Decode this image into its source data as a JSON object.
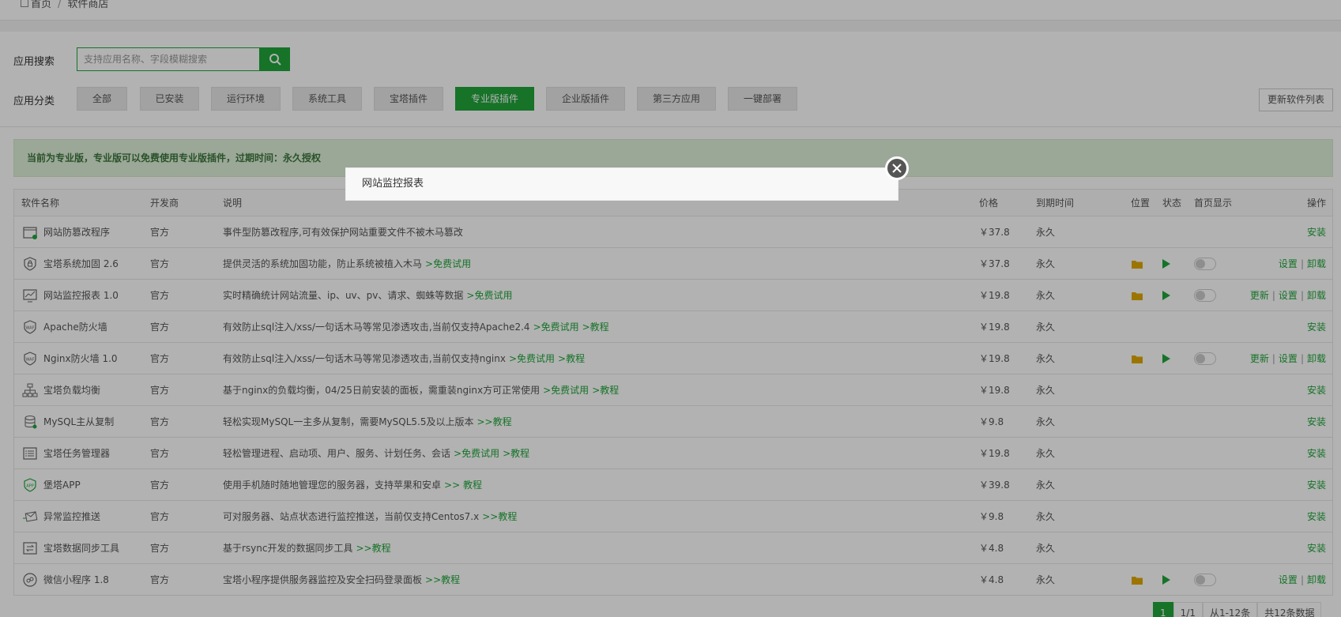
{
  "breadcrumb": {
    "home": "首页",
    "sep": "/",
    "current": "软件商店"
  },
  "search": {
    "label": "应用搜索",
    "placeholder": "支持应用名称、字段模糊搜索"
  },
  "categories": {
    "label": "应用分类",
    "items": [
      "全部",
      "已安装",
      "运行环境",
      "系统工具",
      "宝塔插件",
      "专业版插件",
      "企业版插件",
      "第三方应用",
      "一键部署"
    ],
    "active": "专业版插件"
  },
  "update_button": "更新软件列表",
  "notice": "当前为专业版，专业版可以免费使用专业版插件，过期时间：永久授权",
  "table": {
    "headers": {
      "name": "软件名称",
      "dev": "开发商",
      "desc": "说明",
      "price": "价格",
      "expire": "到期时间",
      "position": "位置",
      "state": "状态",
      "home": "首页显示",
      "ops": "操作"
    },
    "rows": [
      {
        "name": "网站防篡改程序",
        "icon": "website-shield-icon",
        "dev": "官方",
        "desc": "事件型防篡改程序,可有效保护网站重要文件不被木马篡改",
        "links": [],
        "price": "￥37.8",
        "expire": "永久",
        "installed": false,
        "ops": [
          "安装"
        ]
      },
      {
        "name": "宝塔系统加固 2.6",
        "icon": "lock-shield-icon",
        "dev": "官方",
        "desc": "提供灵活的系统加固功能，防止系统被植入木马",
        "links": [
          ">免费试用"
        ],
        "price": "￥37.8",
        "expire": "永久",
        "installed": true,
        "ops": [
          "设置",
          "卸载"
        ]
      },
      {
        "name": "网站监控报表 1.0",
        "icon": "monitor-chart-icon",
        "dev": "官方",
        "desc": "实时精确统计网站流量、ip、uv、pv、请求、蜘蛛等数据",
        "links": [
          ">免费试用"
        ],
        "price": "￥19.8",
        "expire": "永久",
        "installed": true,
        "ops": [
          "更新",
          "设置",
          "卸载"
        ]
      },
      {
        "name": "Apache防火墙",
        "icon": "waf-shield-icon",
        "dev": "官方",
        "desc": "有效防止sql注入/xss/一句话木马等常见渗透攻击,当前仅支持Apache2.4",
        "links": [
          ">免费试用",
          ">教程"
        ],
        "price": "￥19.8",
        "expire": "永久",
        "installed": false,
        "ops": [
          "安装"
        ]
      },
      {
        "name": "Nginx防火墙 1.0",
        "icon": "waf-shield-icon",
        "dev": "官方",
        "desc": "有效防止sql注入/xss/一句话木马等常见渗透攻击,当前仅支持nginx",
        "links": [
          ">免费试用",
          ">教程"
        ],
        "price": "￥19.8",
        "expire": "永久",
        "installed": true,
        "ops": [
          "更新",
          "设置",
          "卸载"
        ]
      },
      {
        "name": "宝塔负载均衡",
        "icon": "network-tree-icon",
        "dev": "官方",
        "desc": "基于nginx的负载均衡，04/25日前安装的面板，需重装nginx方可正常使用",
        "links": [
          ">免费试用",
          ">教程"
        ],
        "price": "￥19.8",
        "expire": "永久",
        "installed": false,
        "ops": [
          "安装"
        ]
      },
      {
        "name": "MySQL主从复制",
        "icon": "database-icon",
        "dev": "官方",
        "desc": "轻松实现MySQL一主多从复制，需要MySQL5.5及以上版本",
        "links": [
          ">>教程"
        ],
        "price": "￥9.8",
        "expire": "永久",
        "installed": false,
        "ops": [
          "安装"
        ]
      },
      {
        "name": "宝塔任务管理器",
        "icon": "task-list-icon",
        "dev": "官方",
        "desc": "轻松管理进程、启动项、用户、服务、计划任务、会话",
        "links": [
          ">免费试用",
          ">教程"
        ],
        "price": "￥19.8",
        "expire": "永久",
        "installed": false,
        "ops": [
          "安装"
        ]
      },
      {
        "name": "堡塔APP",
        "icon": "app-icon",
        "dev": "官方",
        "desc": "使用手机随时随地管理您的服务器，支持苹果和安卓",
        "links": [
          ">> 教程"
        ],
        "price": "￥39.8",
        "expire": "永久",
        "installed": false,
        "ops": [
          "安装"
        ]
      },
      {
        "name": "异常监控推送",
        "icon": "send-mail-icon",
        "dev": "官方",
        "desc": "可对服务器、站点状态进行监控推送，当前仅支持Centos7.x",
        "links": [
          ">>教程"
        ],
        "price": "￥9.8",
        "expire": "永久",
        "installed": false,
        "ops": [
          "安装"
        ]
      },
      {
        "name": "宝塔数据同步工具",
        "icon": "sync-icon",
        "dev": "官方",
        "desc": "基于rsync开发的数据同步工具",
        "links": [
          ">>教程"
        ],
        "price": "￥4.8",
        "expire": "永久",
        "installed": false,
        "ops": [
          "安装"
        ]
      },
      {
        "name": "微信小程序 1.8",
        "icon": "wechat-mini-icon",
        "dev": "官方",
        "desc": "宝塔小程序提供服务器监控及安全扫码登录面板",
        "links": [
          ">>教程"
        ],
        "price": "￥4.8",
        "expire": "永久",
        "installed": true,
        "ops": [
          "设置",
          "卸载"
        ]
      }
    ]
  },
  "pagination": {
    "current": "1",
    "pages": "1/1",
    "range": "从1-12条",
    "total": "共12条数据"
  },
  "modal": {
    "title": "网站监控报表"
  },
  "colors": {
    "accent": "#20a53a",
    "price": "#fc6d26",
    "folder": "#e0a800"
  }
}
